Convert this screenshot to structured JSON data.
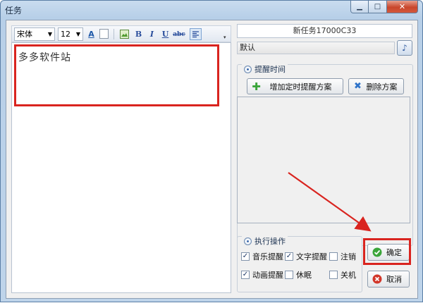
{
  "window": {
    "title": "任务"
  },
  "caption_buttons": {
    "minimize": "▁",
    "maximize": "□",
    "close": "✕"
  },
  "toolbar": {
    "font_family": "宋体",
    "font_size": "12",
    "font_color_glyph": "A",
    "bold": "B",
    "italic": "I",
    "underline": "U",
    "strikethrough": "abc"
  },
  "editor": {
    "content": "多多软件站"
  },
  "task": {
    "name": "新任务17000C33"
  },
  "sound": {
    "value": "默认",
    "button_glyph": "♪"
  },
  "reminder_time": {
    "title": "提醒时间",
    "add_button": "增加定时提醒方案",
    "delete_button": "删除方案"
  },
  "actions": {
    "title": "执行操作",
    "options": [
      {
        "label": "音乐提醒",
        "checked": true
      },
      {
        "label": "文字提醒",
        "checked": true
      },
      {
        "label": "注销",
        "checked": false
      },
      {
        "label": "动画提醒",
        "checked": true
      },
      {
        "label": "休眠",
        "checked": false
      },
      {
        "label": "关机",
        "checked": false
      }
    ]
  },
  "buttons": {
    "ok": "确定",
    "cancel": "取消"
  },
  "colors": {
    "highlight": "#d9241f",
    "ok_icon": "#3aa53a",
    "cancel_icon": "#d2372a"
  }
}
